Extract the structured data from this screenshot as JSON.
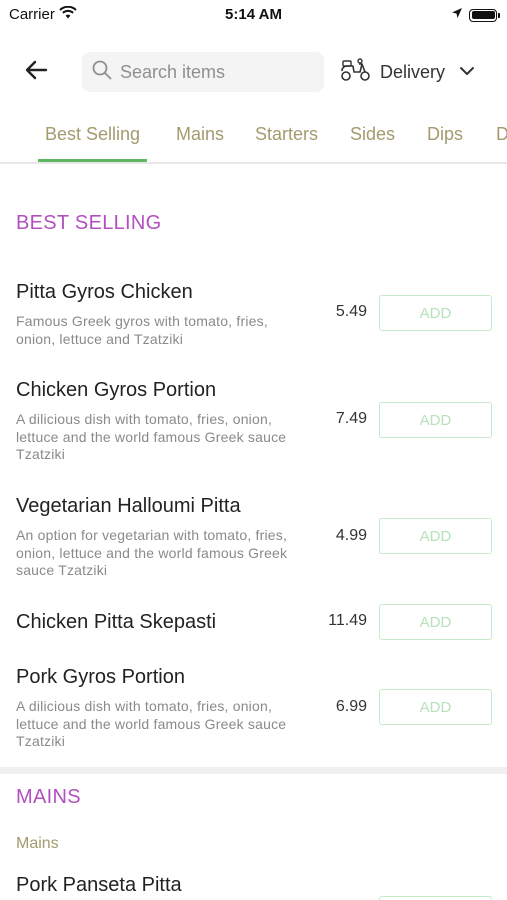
{
  "status_bar": {
    "carrier": "Carrier",
    "time": "5:14 AM"
  },
  "header": {
    "search_placeholder": "Search items",
    "delivery_label": "Delivery"
  },
  "tabs": [
    {
      "label": "Best Selling",
      "active": true
    },
    {
      "label": "Mains",
      "active": false
    },
    {
      "label": "Starters",
      "active": false
    },
    {
      "label": "Sides",
      "active": false
    },
    {
      "label": "Dips",
      "active": false
    },
    {
      "label": "D",
      "active": false
    }
  ],
  "best_selling": {
    "title": "BEST SELLING",
    "items": [
      {
        "name": "Pitta Gyros Chicken",
        "description": "Famous Greek gyros with tomato, fries, onion, lettuce and Tzatziki",
        "price": "5.49",
        "button": "ADD"
      },
      {
        "name": "Chicken Gyros Portion",
        "description": "A dilicious dish with tomato, fries, onion, lettuce and the world famous Greek sauce Tzatziki",
        "price": "7.49",
        "button": "ADD"
      },
      {
        "name": "Vegetarian Halloumi Pitta",
        "description": "An option for vegetarian with tomato, fries, onion, lettuce and the world famous Greek sauce Tzatziki",
        "price": "4.99",
        "button": "ADD"
      },
      {
        "name": "Chicken Pitta Skepasti",
        "description": "",
        "price": "11.49",
        "button": "ADD"
      },
      {
        "name": "Pork Gyros Portion",
        "description": "A dilicious dish with tomato, fries, onion, lettuce and the world famous Greek sauce Tzatziki",
        "price": "6.99",
        "button": "ADD"
      }
    ]
  },
  "mains": {
    "title": "MAINS",
    "subsection": "Mains",
    "items": [
      {
        "name": "Pork Panseta Pitta"
      }
    ]
  },
  "colors": {
    "section_title": "#b350c0",
    "tab_text": "#a39a6e",
    "tab_active_underline": "#5fb760",
    "add_button_border": "#c5ebc9"
  }
}
